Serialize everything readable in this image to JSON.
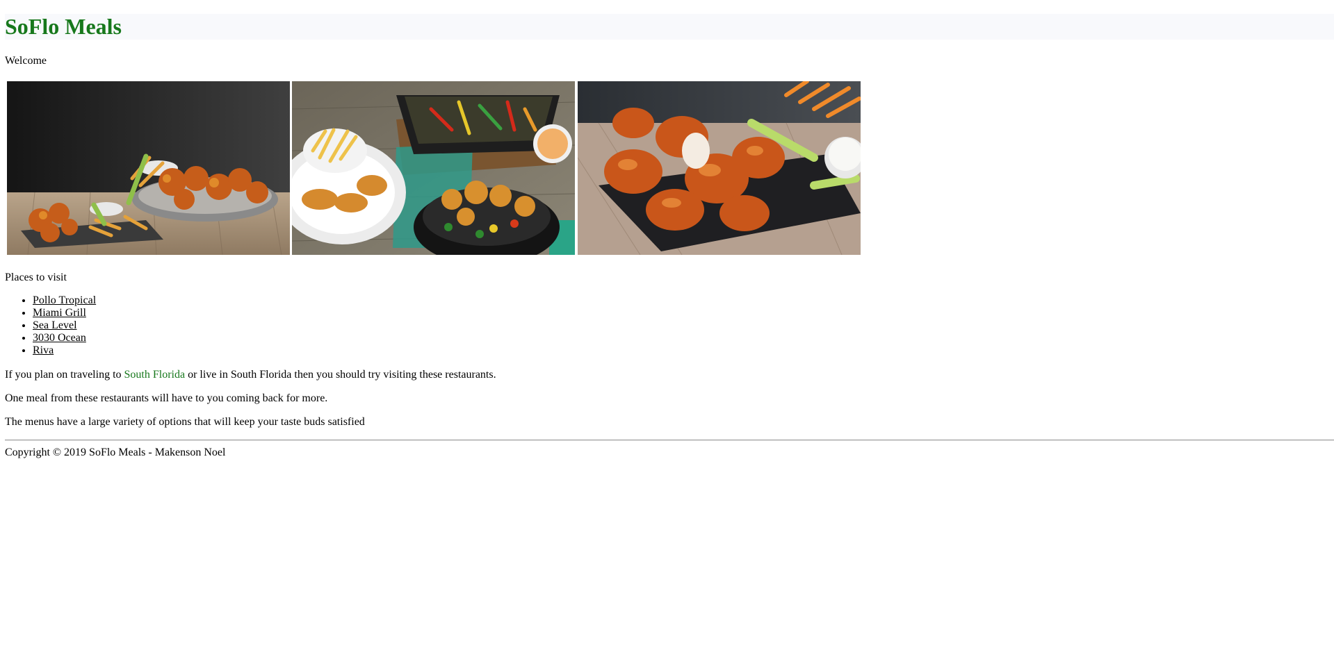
{
  "header": {
    "title": "SoFlo Meals"
  },
  "welcome": "Welcome",
  "gallery": {
    "photos": [
      {
        "icon": "wings-platter-photo"
      },
      {
        "icon": "meal-spread-photo"
      },
      {
        "icon": "glazed-wings-photo"
      }
    ]
  },
  "places": {
    "title": "Places to visit",
    "items": [
      {
        "label": "Pollo Tropical"
      },
      {
        "label": "Miami Grill"
      },
      {
        "label": "Sea Level"
      },
      {
        "label": "3030 Ocean"
      },
      {
        "label": "Riva"
      }
    ]
  },
  "paragraphs": {
    "p1_before": "If you plan on traveling to ",
    "p1_highlight": "South Florida",
    "p1_after": " or live in South Florida then you should try visiting these restaurants.",
    "p2": "One meal from these restaurants will have to you coming back for more.",
    "p3": "The menus have a large variety of options that will keep your taste buds satisfied"
  },
  "footer": {
    "text": "Copyright © 2019 SoFlo Meals - Makenson Noel"
  },
  "colors": {
    "title_green": "#17781c",
    "header_bg": "#f8f9fc"
  }
}
